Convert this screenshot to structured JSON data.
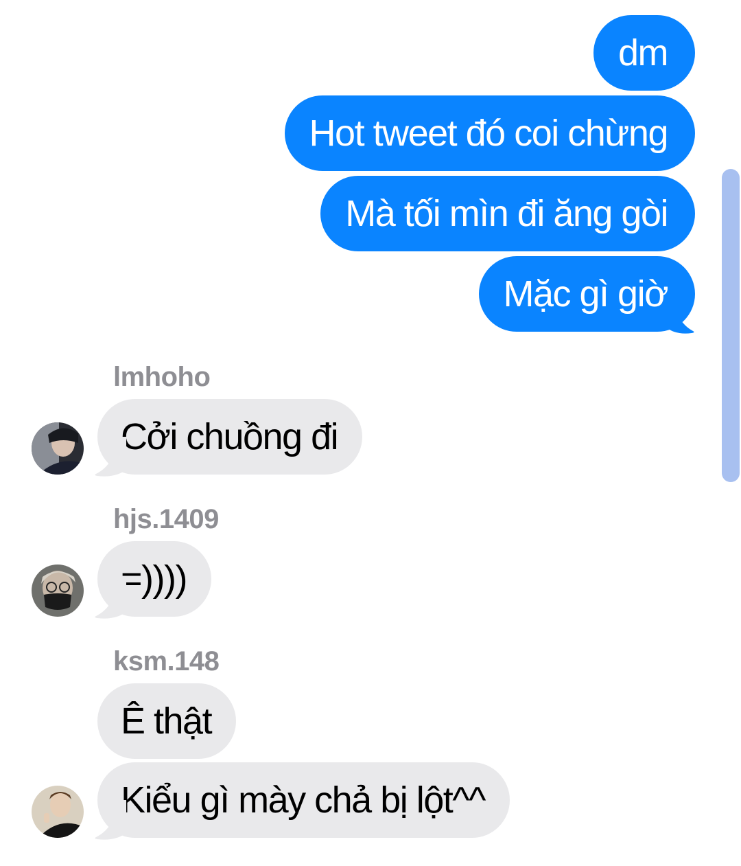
{
  "outgoing": [
    {
      "text": "dm"
    },
    {
      "text": "Hot tweet đó coi chừng"
    },
    {
      "text": "Mà tối mìn đi ăng gòi"
    },
    {
      "text": "Mặc gì giờ"
    }
  ],
  "groups": [
    {
      "sender": "lmhoho",
      "avatar_icon": "user-avatar-icon",
      "messages": [
        {
          "text": "Cởi chuồng đi"
        }
      ]
    },
    {
      "sender": "hjs.1409",
      "avatar_icon": "user-avatar-icon",
      "messages": [
        {
          "text": "=))))"
        }
      ]
    },
    {
      "sender": "ksm.148",
      "avatar_icon": "user-avatar-icon",
      "messages": [
        {
          "text": "Ê thật"
        },
        {
          "text": "Kiểu gì mày chả bị lột^^"
        }
      ]
    }
  ],
  "colors": {
    "outgoing_bubble": "#0a84ff",
    "incoming_bubble": "#e9e9eb",
    "sender_name": "#8e8e93",
    "scrollbar": "#a8c0f0"
  }
}
